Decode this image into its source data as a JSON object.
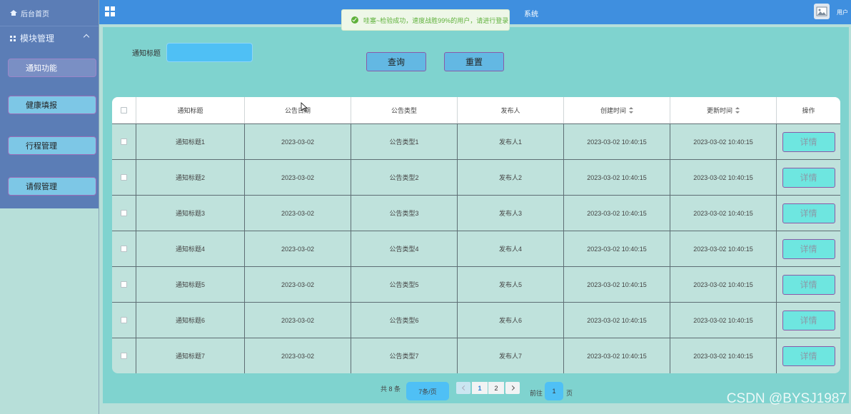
{
  "topbar": {
    "system_title": "系统",
    "user_label": "用户"
  },
  "sidebar": {
    "home": "后台首页",
    "group": "模块管理",
    "items": [
      {
        "label": "通知功能"
      },
      {
        "label": "健康填报"
      },
      {
        "label": "行程管理"
      },
      {
        "label": "请假管理"
      }
    ]
  },
  "toast": {
    "message": "哇塞~检验成功，速度战胜99%的用户，请进行登录"
  },
  "filter": {
    "label": "通知标题",
    "value": "",
    "search_button": "查询",
    "reset_button": "重置"
  },
  "table": {
    "columns": [
      "通知标题",
      "公告日期",
      "公告类型",
      "发布人",
      "创建时间",
      "更新时间",
      "操作"
    ],
    "action_label": "详情",
    "rows": [
      [
        "通知标题1",
        "2023-03-02",
        "公告类型1",
        "发布人1",
        "2023-03-02 10:40:15",
        "2023-03-02 10:40:15"
      ],
      [
        "通知标题2",
        "2023-03-02",
        "公告类型2",
        "发布人2",
        "2023-03-02 10:40:15",
        "2023-03-02 10:40:15"
      ],
      [
        "通知标题3",
        "2023-03-02",
        "公告类型3",
        "发布人3",
        "2023-03-02 10:40:15",
        "2023-03-02 10:40:15"
      ],
      [
        "通知标题4",
        "2023-03-02",
        "公告类型4",
        "发布人4",
        "2023-03-02 10:40:15",
        "2023-03-02 10:40:15"
      ],
      [
        "通知标题5",
        "2023-03-02",
        "公告类型5",
        "发布人5",
        "2023-03-02 10:40:15",
        "2023-03-02 10:40:15"
      ],
      [
        "通知标题6",
        "2023-03-02",
        "公告类型6",
        "发布人6",
        "2023-03-02 10:40:15",
        "2023-03-02 10:40:15"
      ],
      [
        "通知标题7",
        "2023-03-02",
        "公告类型7",
        "发布人7",
        "2023-03-02 10:40:15",
        "2023-03-02 10:40:15"
      ]
    ]
  },
  "pagination": {
    "total": "共 8 条",
    "page_size": "7条/页",
    "pages": [
      "1",
      "2"
    ],
    "goto_label": "前往",
    "goto_value": "1",
    "page_suffix": "页"
  },
  "watermark": "CSDN @BYSJ1987",
  "colors": {
    "topbar": "#3f8fdf",
    "sidebar_menu": "#5b7db6",
    "main_bg": "#7fd3cf",
    "accent_input": "#4fc0f5",
    "detail_button": "#6ee6e0"
  }
}
